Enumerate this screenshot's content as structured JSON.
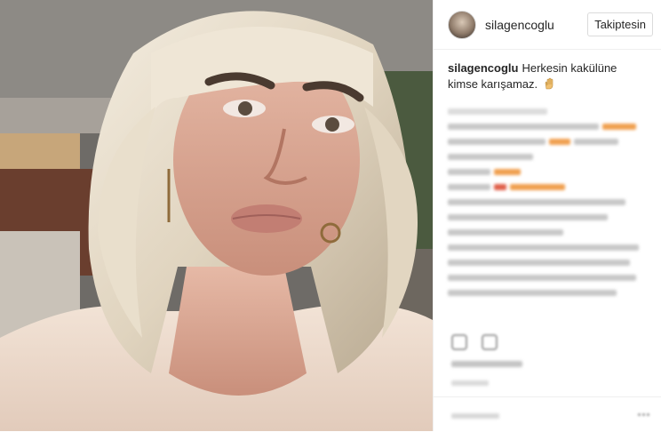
{
  "post": {
    "username": "silagencoglu",
    "follow_button": "Takiptesin",
    "caption_user": "silagencoglu",
    "caption_text": "Herkesin kakülüne kimse karışamaz."
  },
  "icons": {
    "hand": "raised-hand-emoji",
    "avatar": "profile-avatar"
  },
  "colors": {
    "text": "#262626",
    "border": "#dbdbdb"
  }
}
